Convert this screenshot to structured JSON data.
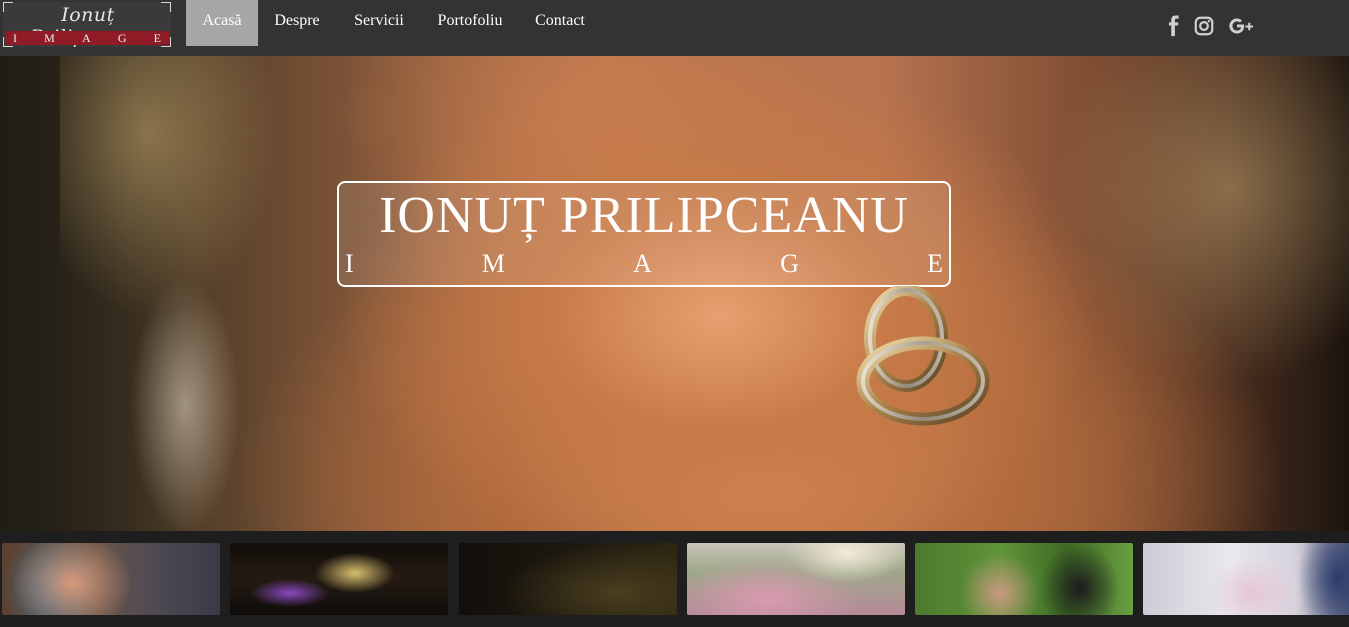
{
  "navbar": {
    "logo": {
      "script": "Ionuț Prilipceanu",
      "image_letters": [
        "I",
        "M",
        "A",
        "G",
        "E"
      ]
    },
    "links": [
      {
        "label": "Acasă",
        "active": true
      },
      {
        "label": "Despre",
        "active": false
      },
      {
        "label": "Servicii",
        "active": false
      },
      {
        "label": "Portofoliu",
        "active": false
      },
      {
        "label": "Contact",
        "active": false
      }
    ],
    "social": [
      "facebook-icon",
      "instagram-icon",
      "google-plus-icon"
    ],
    "active_color": "#a6a6a6",
    "background_color": "#333333"
  },
  "hero": {
    "title": "IONUȚ PRILIPCEANU",
    "subtitle_letters": [
      "I",
      "M",
      "A",
      "G",
      "E"
    ]
  },
  "thumbnails": 6,
  "colors": {
    "logo_band": "#8e1b25",
    "page_background": "#1e1e1e"
  }
}
